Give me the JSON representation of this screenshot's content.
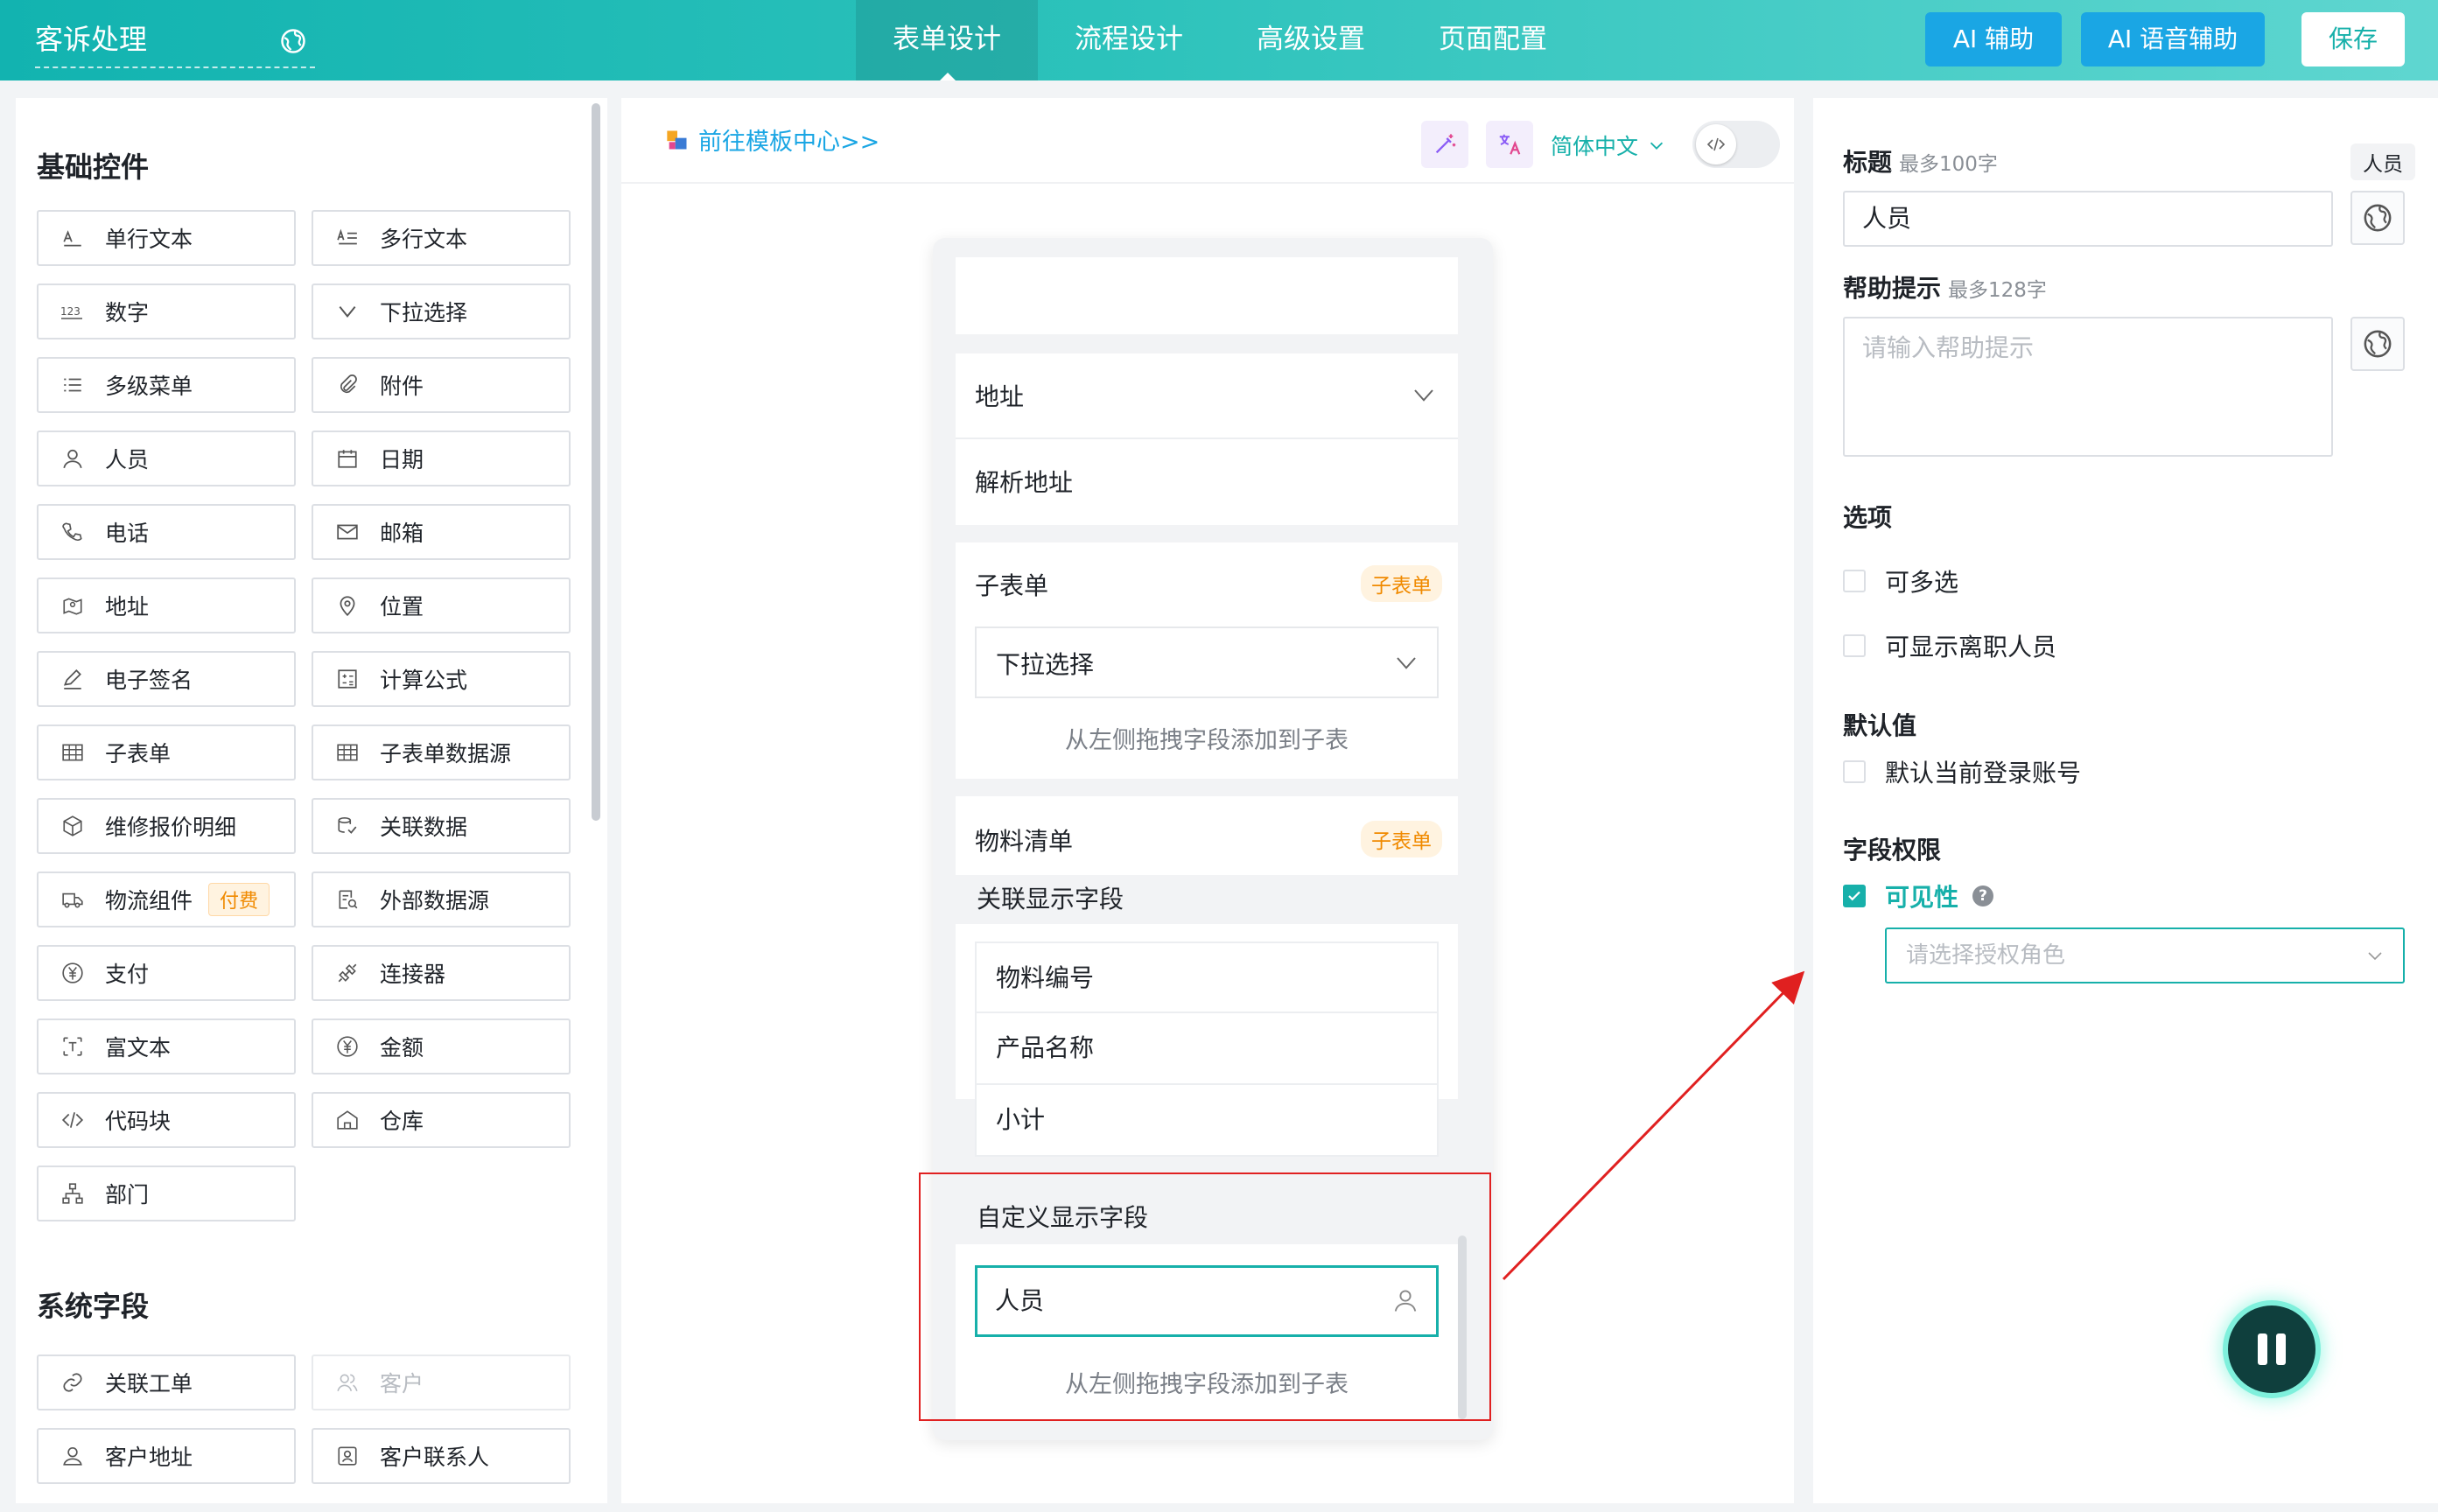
{
  "header": {
    "app_title": "客诉处理",
    "tabs": [
      "表单设计",
      "流程设计",
      "高级设置",
      "页面配置"
    ],
    "active_tab": "表单设计",
    "ai_assist": "AI 辅助",
    "ai_voice": "AI 语音辅助",
    "save": "保存"
  },
  "left": {
    "basic_title": "基础控件",
    "basic_controls": [
      {
        "label": "单行文本",
        "icon": "single-line-text-icon"
      },
      {
        "label": "多行文本",
        "icon": "multi-line-text-icon"
      },
      {
        "label": "数字",
        "icon": "number-icon"
      },
      {
        "label": "下拉选择",
        "icon": "dropdown-icon"
      },
      {
        "label": "多级菜单",
        "icon": "list-icon"
      },
      {
        "label": "附件",
        "icon": "paperclip-icon"
      },
      {
        "label": "人员",
        "icon": "person-icon"
      },
      {
        "label": "日期",
        "icon": "calendar-icon"
      },
      {
        "label": "电话",
        "icon": "phone-icon"
      },
      {
        "label": "邮箱",
        "icon": "mail-icon"
      },
      {
        "label": "地址",
        "icon": "map-icon"
      },
      {
        "label": "位置",
        "icon": "location-pin-icon"
      },
      {
        "label": "电子签名",
        "icon": "pen-icon"
      },
      {
        "label": "计算公式",
        "icon": "calculator-icon"
      },
      {
        "label": "子表单",
        "icon": "table-icon"
      },
      {
        "label": "子表单数据源",
        "icon": "table-source-icon"
      },
      {
        "label": "维修报价明细",
        "icon": "box-icon"
      },
      {
        "label": "关联数据",
        "icon": "related-data-icon"
      },
      {
        "label": "物流组件",
        "icon": "truck-icon",
        "badge": "付费"
      },
      {
        "label": "外部数据源",
        "icon": "external-data-icon"
      },
      {
        "label": "支付",
        "icon": "yuan-icon"
      },
      {
        "label": "连接器",
        "icon": "connector-icon"
      },
      {
        "label": "富文本",
        "icon": "rich-text-icon"
      },
      {
        "label": "金额",
        "icon": "amount-icon"
      },
      {
        "label": "代码块",
        "icon": "code-icon"
      },
      {
        "label": "仓库",
        "icon": "warehouse-icon"
      },
      {
        "label": "部门",
        "icon": "org-chart-icon"
      }
    ],
    "system_title": "系统字段",
    "system_controls": [
      {
        "label": "关联工单",
        "icon": "link-icon"
      },
      {
        "label": "客户",
        "icon": "customer-icon",
        "disabled": true
      },
      {
        "label": "客户地址",
        "icon": "customer-address-icon"
      },
      {
        "label": "客户联系人",
        "icon": "contact-icon"
      }
    ]
  },
  "canvas": {
    "template_link": "前往模板中心>>",
    "language": "简体中文",
    "fields": {
      "address": "地址",
      "parse_address": "解析地址",
      "subform_title": "子表单",
      "subform_badge": "子表单",
      "subform_dropdown": "下拉选择",
      "drag_hint": "从左侧拖拽字段添加到子表",
      "material_title": "物料清单",
      "material_badge": "子表单",
      "related_fields_title": "关联显示字段",
      "related_fields": [
        "物料编号",
        "产品名称",
        "小计"
      ],
      "custom_fields_title": "自定义显示字段",
      "custom_person": "人员",
      "drag_hint_2": "从左侧拖拽字段添加到子表"
    }
  },
  "right": {
    "title_label": "标题",
    "title_limit": "最多100字",
    "title_chip": "人员",
    "title_value": "人员",
    "help_label": "帮助提示",
    "help_limit": "最多128字",
    "help_placeholder": "请输入帮助提示",
    "options_label": "选项",
    "option_multi": "可多选",
    "option_show_resigned": "可显示离职人员",
    "default_label": "默认值",
    "default_current_account": "默认当前登录账号",
    "permission_label": "字段权限",
    "visibility_label": "可见性",
    "visibility_checked": true,
    "role_placeholder": "请选择授权角色"
  },
  "colors": {
    "brand": "#17b0aa",
    "ai_button": "#1aa6e4",
    "badge": "#f08a00",
    "highlight": "#e02020"
  }
}
